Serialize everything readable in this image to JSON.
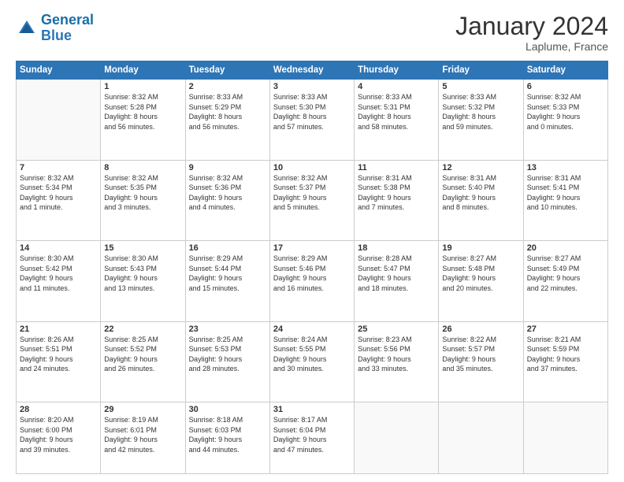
{
  "logo": {
    "line1": "General",
    "line2": "Blue"
  },
  "title": "January 2024",
  "location": "Laplume, France",
  "days_of_week": [
    "Sunday",
    "Monday",
    "Tuesday",
    "Wednesday",
    "Thursday",
    "Friday",
    "Saturday"
  ],
  "weeks": [
    [
      {
        "day": "",
        "info": ""
      },
      {
        "day": "1",
        "info": "Sunrise: 8:32 AM\nSunset: 5:28 PM\nDaylight: 8 hours\nand 56 minutes."
      },
      {
        "day": "2",
        "info": "Sunrise: 8:33 AM\nSunset: 5:29 PM\nDaylight: 8 hours\nand 56 minutes."
      },
      {
        "day": "3",
        "info": "Sunrise: 8:33 AM\nSunset: 5:30 PM\nDaylight: 8 hours\nand 57 minutes."
      },
      {
        "day": "4",
        "info": "Sunrise: 8:33 AM\nSunset: 5:31 PM\nDaylight: 8 hours\nand 58 minutes."
      },
      {
        "day": "5",
        "info": "Sunrise: 8:33 AM\nSunset: 5:32 PM\nDaylight: 8 hours\nand 59 minutes."
      },
      {
        "day": "6",
        "info": "Sunrise: 8:32 AM\nSunset: 5:33 PM\nDaylight: 9 hours\nand 0 minutes."
      }
    ],
    [
      {
        "day": "7",
        "info": "Sunrise: 8:32 AM\nSunset: 5:34 PM\nDaylight: 9 hours\nand 1 minute."
      },
      {
        "day": "8",
        "info": "Sunrise: 8:32 AM\nSunset: 5:35 PM\nDaylight: 9 hours\nand 3 minutes."
      },
      {
        "day": "9",
        "info": "Sunrise: 8:32 AM\nSunset: 5:36 PM\nDaylight: 9 hours\nand 4 minutes."
      },
      {
        "day": "10",
        "info": "Sunrise: 8:32 AM\nSunset: 5:37 PM\nDaylight: 9 hours\nand 5 minutes."
      },
      {
        "day": "11",
        "info": "Sunrise: 8:31 AM\nSunset: 5:38 PM\nDaylight: 9 hours\nand 7 minutes."
      },
      {
        "day": "12",
        "info": "Sunrise: 8:31 AM\nSunset: 5:40 PM\nDaylight: 9 hours\nand 8 minutes."
      },
      {
        "day": "13",
        "info": "Sunrise: 8:31 AM\nSunset: 5:41 PM\nDaylight: 9 hours\nand 10 minutes."
      }
    ],
    [
      {
        "day": "14",
        "info": "Sunrise: 8:30 AM\nSunset: 5:42 PM\nDaylight: 9 hours\nand 11 minutes."
      },
      {
        "day": "15",
        "info": "Sunrise: 8:30 AM\nSunset: 5:43 PM\nDaylight: 9 hours\nand 13 minutes."
      },
      {
        "day": "16",
        "info": "Sunrise: 8:29 AM\nSunset: 5:44 PM\nDaylight: 9 hours\nand 15 minutes."
      },
      {
        "day": "17",
        "info": "Sunrise: 8:29 AM\nSunset: 5:46 PM\nDaylight: 9 hours\nand 16 minutes."
      },
      {
        "day": "18",
        "info": "Sunrise: 8:28 AM\nSunset: 5:47 PM\nDaylight: 9 hours\nand 18 minutes."
      },
      {
        "day": "19",
        "info": "Sunrise: 8:27 AM\nSunset: 5:48 PM\nDaylight: 9 hours\nand 20 minutes."
      },
      {
        "day": "20",
        "info": "Sunrise: 8:27 AM\nSunset: 5:49 PM\nDaylight: 9 hours\nand 22 minutes."
      }
    ],
    [
      {
        "day": "21",
        "info": "Sunrise: 8:26 AM\nSunset: 5:51 PM\nDaylight: 9 hours\nand 24 minutes."
      },
      {
        "day": "22",
        "info": "Sunrise: 8:25 AM\nSunset: 5:52 PM\nDaylight: 9 hours\nand 26 minutes."
      },
      {
        "day": "23",
        "info": "Sunrise: 8:25 AM\nSunset: 5:53 PM\nDaylight: 9 hours\nand 28 minutes."
      },
      {
        "day": "24",
        "info": "Sunrise: 8:24 AM\nSunset: 5:55 PM\nDaylight: 9 hours\nand 30 minutes."
      },
      {
        "day": "25",
        "info": "Sunrise: 8:23 AM\nSunset: 5:56 PM\nDaylight: 9 hours\nand 33 minutes."
      },
      {
        "day": "26",
        "info": "Sunrise: 8:22 AM\nSunset: 5:57 PM\nDaylight: 9 hours\nand 35 minutes."
      },
      {
        "day": "27",
        "info": "Sunrise: 8:21 AM\nSunset: 5:59 PM\nDaylight: 9 hours\nand 37 minutes."
      }
    ],
    [
      {
        "day": "28",
        "info": "Sunrise: 8:20 AM\nSunset: 6:00 PM\nDaylight: 9 hours\nand 39 minutes."
      },
      {
        "day": "29",
        "info": "Sunrise: 8:19 AM\nSunset: 6:01 PM\nDaylight: 9 hours\nand 42 minutes."
      },
      {
        "day": "30",
        "info": "Sunrise: 8:18 AM\nSunset: 6:03 PM\nDaylight: 9 hours\nand 44 minutes."
      },
      {
        "day": "31",
        "info": "Sunrise: 8:17 AM\nSunset: 6:04 PM\nDaylight: 9 hours\nand 47 minutes."
      },
      {
        "day": "",
        "info": ""
      },
      {
        "day": "",
        "info": ""
      },
      {
        "day": "",
        "info": ""
      }
    ]
  ]
}
